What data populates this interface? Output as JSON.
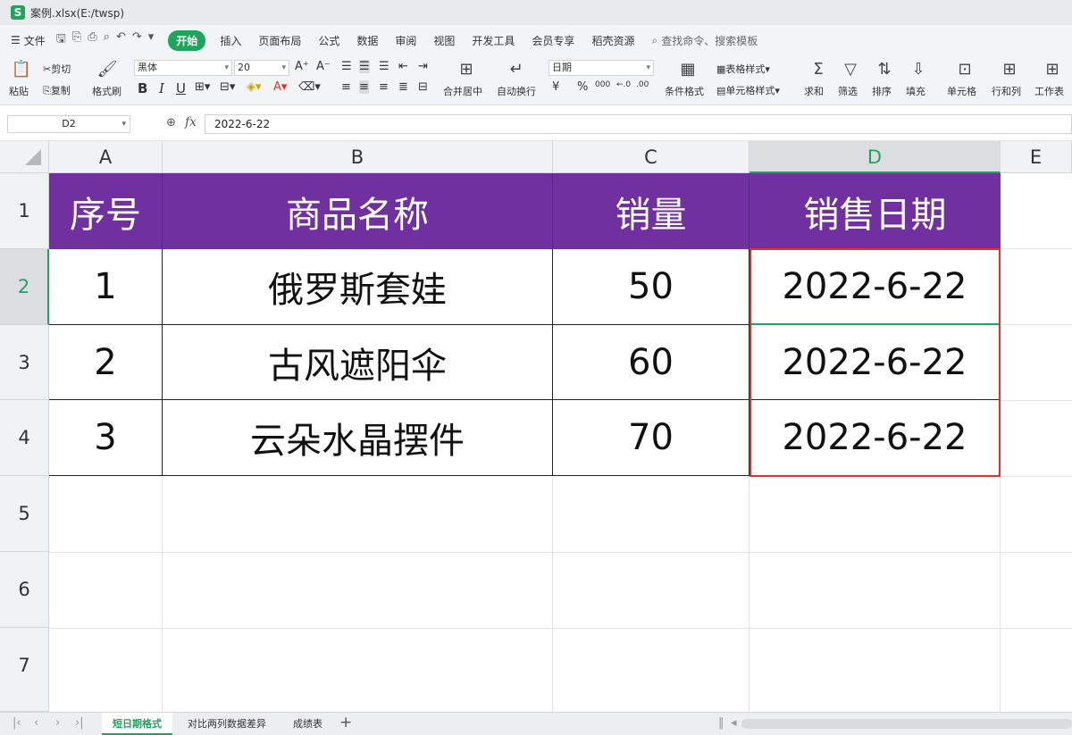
{
  "window": {
    "title": "案例.xlsx(E:/twsp)",
    "logo": "S"
  },
  "menu": {
    "file": "文件",
    "tabs": [
      "开始",
      "插入",
      "页面布局",
      "公式",
      "数据",
      "审阅",
      "视图",
      "开发工具",
      "会员专享",
      "稻壳资源"
    ],
    "search": "查找命令、搜索模板"
  },
  "ribbon": {
    "paste": "粘贴",
    "cut": "剪切",
    "copy": "复制",
    "format_painter": "格式刷",
    "font": "黑体",
    "font_size": "20",
    "bold": "B",
    "italic": "I",
    "underline": "U",
    "merge": "合并居中",
    "wrap": "自动换行",
    "number_format": "日期",
    "currency": "¥",
    "percent": "%",
    "thousands": "000",
    "cond_format": "条件格式",
    "table_style": "表格样式",
    "cell_style": "单元格样式",
    "sum": "求和",
    "filter": "筛选",
    "sort": "排序",
    "fill": "填充",
    "cells": "单元格",
    "rowcol": "行和列",
    "sheet": "工作表"
  },
  "formula_bar": {
    "name_box": "D2",
    "fx": "fx",
    "value": "2022-6-22"
  },
  "columns": [
    "A",
    "B",
    "C",
    "D",
    "E"
  ],
  "rows": [
    "1",
    "2",
    "3",
    "4",
    "5",
    "6",
    "7"
  ],
  "table": {
    "headers": [
      "序号",
      "商品名称",
      "销量",
      "销售日期"
    ],
    "rows": [
      [
        "1",
        "俄罗斯套娃",
        "50",
        "2022-6-22"
      ],
      [
        "2",
        "古风遮阳伞",
        "60",
        "2022-6-22"
      ],
      [
        "3",
        "云朵水晶摆件",
        "70",
        "2022-6-22"
      ]
    ]
  },
  "sheets": [
    "短日期格式",
    "对比两列数据差异",
    "成绩表"
  ],
  "colors": {
    "header_bg": "#7030a0",
    "accent": "#1fa55b",
    "highlight": "#e0322b"
  }
}
